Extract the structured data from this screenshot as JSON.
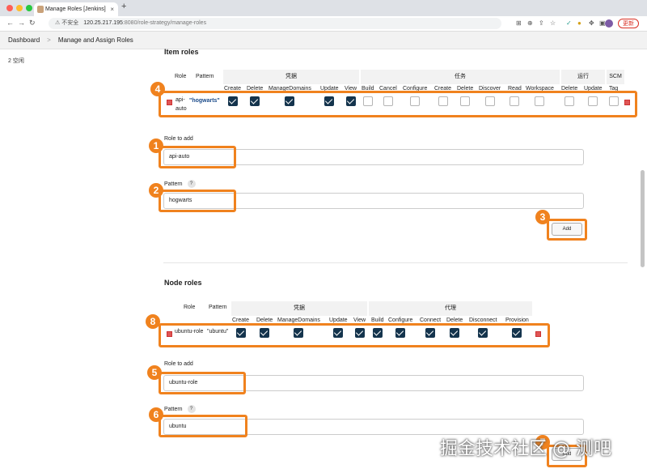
{
  "browser": {
    "tab_title": "Manage Roles [Jenkins]",
    "tab_close": "×",
    "new_tab": "+",
    "insecure": "不安全",
    "url_host": "120.25.217.195",
    "url_path": ":8080/role-strategy/manage-roles",
    "update_label": "更新"
  },
  "breadcrumb": {
    "items": [
      "Dashboard",
      "Manage and Assign Roles"
    ],
    "separator": ">"
  },
  "sidebar": {
    "item": "2 空闲"
  },
  "item_roles": {
    "title": "Item roles",
    "col_role": "Role",
    "col_pattern": "Pattern",
    "groups": [
      "凭据",
      "任务",
      "运行",
      "SCM"
    ],
    "perms": [
      "Create",
      "Delete",
      "ManageDomains",
      "Update",
      "View",
      "Build",
      "Cancel",
      "Configure",
      "Create",
      "Delete",
      "Discover",
      "Read",
      "Workspace",
      "Delete",
      "Update",
      "Tag"
    ],
    "row": {
      "role_line1": "api-",
      "role_line2": "auto",
      "pattern": "\"hogwarts\"",
      "checks": [
        true,
        true,
        true,
        true,
        true,
        false,
        false,
        false,
        false,
        false,
        false,
        false,
        false,
        false,
        false,
        false
      ]
    },
    "role_to_add_label": "Role to add",
    "role_to_add_value": "api-auto",
    "pattern_label": "Pattern",
    "pattern_help": "?",
    "pattern_value": "hogwarts",
    "add_label": "Add"
  },
  "node_roles": {
    "title": "Node roles",
    "col_role": "Role",
    "col_pattern": "Pattern",
    "groups": [
      "凭据",
      "代理"
    ],
    "perms": [
      "Create",
      "Delete",
      "ManageDomains",
      "Update",
      "View",
      "Build",
      "Configure",
      "Connect",
      "Delete",
      "Disconnect",
      "Provision"
    ],
    "row": {
      "role": "ubuntu-role",
      "pattern": "\"ubuntu\"",
      "checks": [
        true,
        true,
        true,
        true,
        true,
        true,
        true,
        true,
        true,
        true,
        true
      ]
    },
    "role_to_add_label": "Role to add",
    "role_to_add_value": "ubuntu-role",
    "pattern_label": "Pattern",
    "pattern_help": "?",
    "pattern_value": "ubuntu",
    "add_label": "Add"
  },
  "badges": [
    "1",
    "2",
    "3",
    "4",
    "5",
    "6",
    "7",
    "8"
  ],
  "colors": {
    "highlight": "#f0821e",
    "checkbox_on": "#14344d",
    "delete": "#e05555"
  },
  "watermark": "掘金技术社区 @ 测吧"
}
